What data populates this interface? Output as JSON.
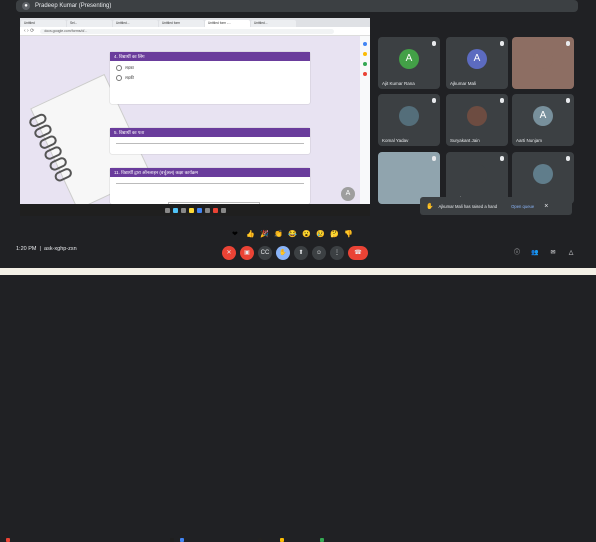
{
  "banner": {
    "presenter": "Pradeep Kumar (Presenting)"
  },
  "shared_screen": {
    "tabs": [
      "",
      "Untitled",
      "Sel...",
      "Untitled...",
      "Untitled form",
      "Untitled form -...",
      "Untitled..."
    ],
    "url": "docs.google.com/forms/d/...",
    "form": {
      "card1_title": "4. विद्यार्थी का लिंग",
      "card1_options": [
        "लड़का",
        "लड़की"
      ],
      "card2_title": "5. विद्यार्थी का पता",
      "card3_title": "11. विद्यार्थी द्वारा ऑनलाइन (वर्चुअल) कक्षा कार्यक्रम"
    },
    "tooltip_text": "Ajkumar Mali is requesting to present",
    "tooltip_button": "Stop sharing",
    "tooltip2": "Hide",
    "avatar_letter": "A"
  },
  "tiles": [
    {
      "name": "Ajit Kumar Rana",
      "letter": "A",
      "color": "#43a047"
    },
    {
      "name": "Ajkumar Mali",
      "letter": "A",
      "color": "#5c6bc0"
    },
    {
      "name": "",
      "letter": "",
      "color": "#8d6e63"
    },
    {
      "name": "Komal Yadav",
      "letter": "",
      "color": "#546e7a"
    },
    {
      "name": "Suryakant Jain",
      "letter": "",
      "color": "#6d4c41"
    },
    {
      "name": "Aarti Nunjam",
      "letter": "A",
      "color": "#78909c"
    },
    {
      "name": "",
      "letter": "",
      "color": "#90a4ae"
    },
    {
      "name": "17 others",
      "letter": "",
      "color": "#3c4043"
    },
    {
      "name": "",
      "letter": "",
      "color": "#607d8b"
    }
  ],
  "toast": {
    "text": "Ajkumar Mali has raised a hand",
    "action": "Open queue"
  },
  "bottom": {
    "time": "1:20 PM",
    "code": "ask-xghp-zsn"
  },
  "reactions": [
    "❤",
    "👍",
    "🎉",
    "👏",
    "😂",
    "😮",
    "😢",
    "🤔",
    "👎"
  ],
  "controls": [
    "mic-off",
    "camera",
    "captions",
    "emoji",
    "present",
    "raise-hand",
    "more",
    "leave"
  ],
  "colors": {
    "accent": "#6a3c9c",
    "leave": "#ea4335"
  }
}
